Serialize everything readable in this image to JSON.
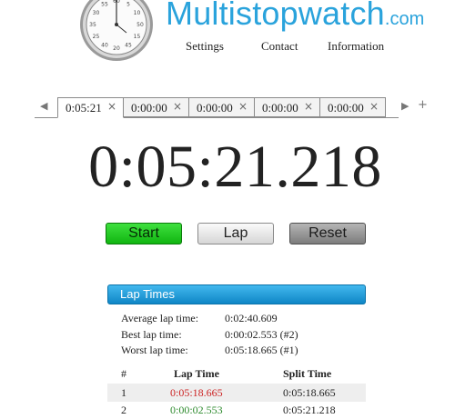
{
  "brand": {
    "name": "Multistopwatch",
    "tld": ".com"
  },
  "nav": [
    "Settings",
    "Contact",
    "Information"
  ],
  "tabs": [
    {
      "label": "0:05:21",
      "active": true
    },
    {
      "label": "0:00:00",
      "active": false
    },
    {
      "label": "0:00:00",
      "active": false
    },
    {
      "label": "0:00:00",
      "active": false
    },
    {
      "label": "0:00:00",
      "active": false
    }
  ],
  "tab_controls": {
    "prev": "◀",
    "next": "▶",
    "add": "+",
    "close": "×"
  },
  "display_time": "0:05:21.218",
  "buttons": {
    "start": "Start",
    "lap": "Lap",
    "reset": "Reset"
  },
  "lap_panel": {
    "title": "Lap Times",
    "stats": [
      {
        "label": "Average lap time:",
        "value": "0:02:40.609"
      },
      {
        "label": "Best lap time:",
        "value": "0:00:02.553 (#2)"
      },
      {
        "label": "Worst lap time:",
        "value": "0:05:18.665 (#1)"
      }
    ],
    "columns": [
      "#",
      "Lap Time",
      "Split Time"
    ],
    "rows": [
      {
        "num": "1",
        "lap": "0:05:18.665",
        "split": "0:05:18.665"
      },
      {
        "num": "2",
        "lap": "0:00:02.553",
        "split": "0:05:21.218"
      }
    ]
  },
  "colors": {
    "brand": "#2aa3dc",
    "worst_lap": "#cc2222",
    "best_lap": "#2e8b2e",
    "start_button": "#11b511",
    "panel_header": "#1a96d6"
  },
  "clock_face_numbers": [
    "55",
    "60",
    "5",
    "10",
    "50",
    "15",
    "45",
    "20",
    "40",
    "25",
    "35",
    "30"
  ]
}
